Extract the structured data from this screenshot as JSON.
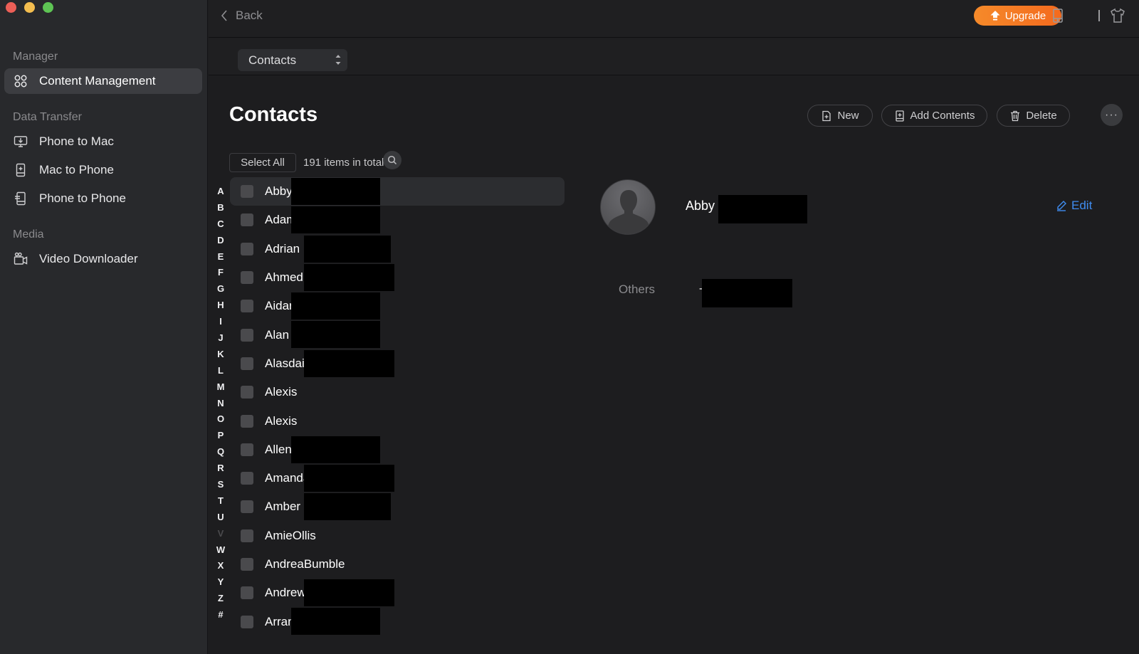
{
  "window": {
    "traffic_lights": [
      "close",
      "minimize",
      "maximize"
    ]
  },
  "sidebar": {
    "sections": [
      {
        "label": "Manager",
        "items": [
          {
            "label": "Content Management",
            "icon": "grid-command-icon",
            "active": true
          }
        ]
      },
      {
        "label": "Data Transfer",
        "items": [
          {
            "label": "Phone to Mac",
            "icon": "monitor-download-icon",
            "active": false
          },
          {
            "label": "Mac to Phone",
            "icon": "phone-plus-icon",
            "active": false
          },
          {
            "label": "Phone to Phone",
            "icon": "phone-transfer-icon",
            "active": false
          }
        ]
      },
      {
        "label": "Media",
        "items": [
          {
            "label": "Video Downloader",
            "icon": "video-camera-icon",
            "active": false
          }
        ]
      }
    ]
  },
  "topbar": {
    "back_label": "Back",
    "upgrade_label": "Upgrade",
    "upgrade_color": "#f47a24",
    "icons": [
      "device-icon",
      "tshirt-icon"
    ]
  },
  "subbar": {
    "category_select": "Contacts"
  },
  "main": {
    "title": "Contacts",
    "actions": {
      "new_label": "New",
      "add_contents_label": "Add Contents",
      "delete_label": "Delete",
      "more_label": "···"
    },
    "select_all_label": "Select All",
    "total_label": "191 items in total",
    "alphabet": [
      "A",
      "B",
      "C",
      "D",
      "E",
      "F",
      "G",
      "H",
      "I",
      "J",
      "K",
      "L",
      "M",
      "N",
      "O",
      "P",
      "Q",
      "R",
      "S",
      "T",
      "U",
      "V",
      "W",
      "X",
      "Y",
      "Z",
      "#"
    ],
    "alphabet_disabled": [
      "V"
    ],
    "contacts": [
      {
        "name": "Abby",
        "selected": true,
        "redacted": true
      },
      {
        "name": "Adam",
        "selected": false,
        "redacted": true
      },
      {
        "name": "Adrian",
        "selected": false,
        "redacted": true
      },
      {
        "name": "Ahmed",
        "selected": false,
        "redacted": true
      },
      {
        "name": "Aidar",
        "selected": false,
        "redacted": true
      },
      {
        "name": "Alan",
        "selected": false,
        "redacted": true
      },
      {
        "name": "Alasdair",
        "selected": false,
        "redacted": true
      },
      {
        "name": "Alexis",
        "selected": false,
        "redacted": false
      },
      {
        "name": "Alexis",
        "selected": false,
        "redacted": false
      },
      {
        "name": "Allen",
        "selected": false,
        "redacted": true
      },
      {
        "name": "Amanda",
        "selected": false,
        "redacted": true
      },
      {
        "name": "Amber",
        "selected": false,
        "redacted": true
      },
      {
        "name": "AmieOllis",
        "selected": false,
        "redacted": false
      },
      {
        "name": "AndreaBumble",
        "selected": false,
        "redacted": false
      },
      {
        "name": "Andrew",
        "selected": false,
        "redacted": true
      },
      {
        "name": "Arran",
        "selected": false,
        "redacted": true
      }
    ],
    "detail": {
      "name": "Abby",
      "edit_label": "Edit",
      "edit_color": "#3f8cf0",
      "others_label": "Others",
      "others_value": "-"
    }
  }
}
